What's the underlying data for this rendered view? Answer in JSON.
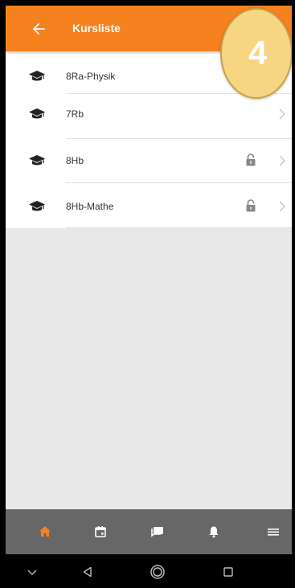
{
  "appbar": {
    "title": "Kursliste",
    "back_icon": "arrow-left-icon",
    "color": "#f5821f"
  },
  "step_badge": {
    "value": "4",
    "color": "#f7d683"
  },
  "courses": [
    {
      "name": "8Ra-Physik",
      "locked": false
    },
    {
      "name": "7Rb",
      "locked": false
    },
    {
      "name": "8Hb",
      "locked": true
    },
    {
      "name": "8Hb-Mathe",
      "locked": true
    }
  ],
  "bottom_nav": {
    "active": "home",
    "active_color": "#f5821f",
    "items": [
      "home-icon",
      "calendar-icon",
      "messages-icon",
      "bell-icon",
      "menu-icon"
    ]
  },
  "system_nav": {
    "items": [
      "chevron-down-icon",
      "back-triangle-icon",
      "home-circle-icon",
      "recent-square-icon"
    ]
  }
}
